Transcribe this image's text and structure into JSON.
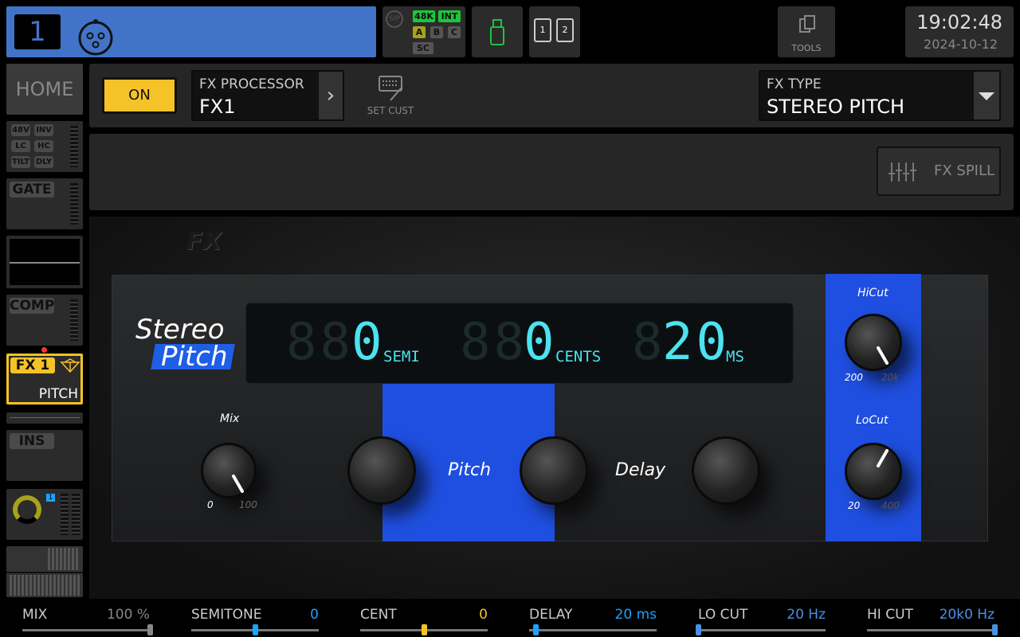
{
  "topbar": {
    "channel_number": "1",
    "channel_color": "#4174c8",
    "status": {
      "sip": "SIP",
      "rate": "48K",
      "clock": "INT",
      "a": "A",
      "b": "B",
      "c": "C",
      "sc": "SC"
    },
    "sd_cards": [
      "1",
      "2"
    ],
    "tools_label": "TOOLS",
    "time": "19:02:48",
    "date": "2024-10-12"
  },
  "sidebar": {
    "home": "HOME",
    "eq_tags": [
      "48V",
      "INV",
      "LC",
      "HC",
      "TILT",
      "DLY"
    ],
    "gate": "GATE",
    "comp": "COMP",
    "fx_slot": "FX 1",
    "fx_name": "PITCH",
    "ins": "INS",
    "send_number": "1"
  },
  "header": {
    "on_label": "ON",
    "processor_label": "FX PROCESSOR",
    "processor_value": "FX1",
    "set_cust": "SET CUST",
    "type_label": "FX TYPE",
    "type_value": "STEREO PITCH",
    "fx_spill": "FX SPILL"
  },
  "rack": {
    "logo": "FX",
    "title_line1": "Stereo",
    "title_line2": "Pitch",
    "display": {
      "semi": "0",
      "semi_unit": "SEMI",
      "cents": "0",
      "cents_unit": "CENTS",
      "ms": "20",
      "ms_unit": "MS"
    },
    "mix": {
      "label": "Mix",
      "min": "0",
      "max": "100"
    },
    "pitch_label": "Pitch",
    "delay_label": "Delay",
    "hicut": {
      "label": "HiCut",
      "min": "200",
      "max": "20k"
    },
    "locut": {
      "label": "LoCut",
      "min": "20",
      "max": "400"
    }
  },
  "params": [
    {
      "label": "MIX",
      "value": "100 %",
      "position": 1.0,
      "color": "#888888"
    },
    {
      "label": "SEMITONE",
      "value": "0",
      "position": 0.5,
      "color": "#1aa3ff"
    },
    {
      "label": "CENT",
      "value": "0",
      "position": 0.5,
      "color": "#f5c327"
    },
    {
      "label": "DELAY",
      "value": "20 ms",
      "position": 0.05,
      "color": "#1aa3ff"
    },
    {
      "label": "LO CUT",
      "value": "20 Hz",
      "position": 0.0,
      "color": "#4a90e2"
    },
    {
      "label": "HI CUT",
      "value": "20k0 Hz",
      "position": 1.0,
      "color": "#4a90e2"
    }
  ],
  "colors": {
    "accent_yellow": "#f5c327",
    "lcd": "#4be3ef",
    "panel_blue": "#1f4fe0"
  }
}
